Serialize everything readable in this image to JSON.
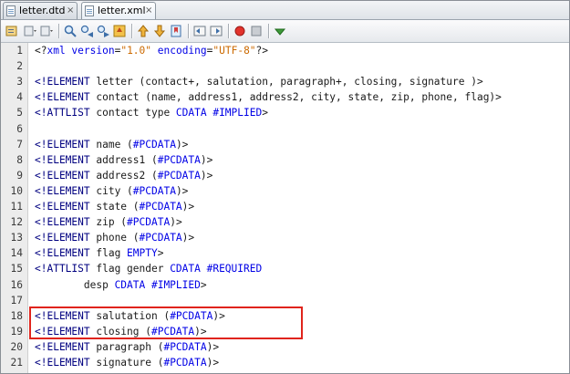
{
  "tabs": [
    {
      "label": "letter.dtd",
      "close": "×"
    },
    {
      "label": "letter.xml",
      "close": "×"
    }
  ],
  "toolbar": {
    "icons": [
      "source-view-icon",
      "back-history-icon",
      "forward-history-icon",
      "find-icon",
      "find-previous-icon",
      "find-next-icon",
      "toggle-highlight-icon",
      "previous-bookmark-icon",
      "next-bookmark-icon",
      "toggle-bookmark-icon",
      "shift-left-icon",
      "shift-right-icon",
      "start-macro-icon",
      "stop-macro-icon",
      "check-xml-icon"
    ]
  },
  "editor": {
    "lines": [
      {
        "n": "1",
        "segs": [
          {
            "t": "<?",
            "c": ""
          },
          {
            "t": "xml version",
            "c": "blue"
          },
          {
            "t": "=",
            "c": ""
          },
          {
            "t": "\"1.0\"",
            "c": "str"
          },
          {
            "t": " encoding",
            "c": "blue"
          },
          {
            "t": "=",
            "c": ""
          },
          {
            "t": "\"UTF-8\"",
            "c": "str"
          },
          {
            "t": "?>",
            "c": ""
          }
        ]
      },
      {
        "n": "2",
        "segs": []
      },
      {
        "n": "3",
        "segs": [
          {
            "t": "<!ELEMENT",
            "c": "k"
          },
          {
            "t": " letter (contact+, salutation, paragraph+, closing, signature )>",
            "c": ""
          }
        ]
      },
      {
        "n": "4",
        "segs": [
          {
            "t": "<!ELEMENT",
            "c": "k"
          },
          {
            "t": " contact (name, address1, address2, city, state, zip, phone, flag)>",
            "c": ""
          }
        ]
      },
      {
        "n": "5",
        "segs": [
          {
            "t": "<!ATTLIST",
            "c": "k"
          },
          {
            "t": " contact type ",
            "c": ""
          },
          {
            "t": "CDATA #IMPLIED",
            "c": "blue"
          },
          {
            "t": ">",
            "c": ""
          }
        ]
      },
      {
        "n": "6",
        "segs": []
      },
      {
        "n": "7",
        "segs": [
          {
            "t": "<!ELEMENT",
            "c": "k"
          },
          {
            "t": " name (",
            "c": ""
          },
          {
            "t": "#PCDATA",
            "c": "blue"
          },
          {
            "t": ")>",
            "c": ""
          }
        ]
      },
      {
        "n": "8",
        "segs": [
          {
            "t": "<!ELEMENT",
            "c": "k"
          },
          {
            "t": " address1 (",
            "c": ""
          },
          {
            "t": "#PCDATA",
            "c": "blue"
          },
          {
            "t": ")>",
            "c": ""
          }
        ]
      },
      {
        "n": "9",
        "segs": [
          {
            "t": "<!ELEMENT",
            "c": "k"
          },
          {
            "t": " address2 (",
            "c": ""
          },
          {
            "t": "#PCDATA",
            "c": "blue"
          },
          {
            "t": ")>",
            "c": ""
          }
        ]
      },
      {
        "n": "10",
        "segs": [
          {
            "t": "<!ELEMENT",
            "c": "k"
          },
          {
            "t": " city (",
            "c": ""
          },
          {
            "t": "#PCDATA",
            "c": "blue"
          },
          {
            "t": ")>",
            "c": ""
          }
        ]
      },
      {
        "n": "11",
        "segs": [
          {
            "t": "<!ELEMENT",
            "c": "k"
          },
          {
            "t": " state (",
            "c": ""
          },
          {
            "t": "#PCDATA",
            "c": "blue"
          },
          {
            "t": ")>",
            "c": ""
          }
        ]
      },
      {
        "n": "12",
        "segs": [
          {
            "t": "<!ELEMENT",
            "c": "k"
          },
          {
            "t": " zip (",
            "c": ""
          },
          {
            "t": "#PCDATA",
            "c": "blue"
          },
          {
            "t": ")>",
            "c": ""
          }
        ]
      },
      {
        "n": "13",
        "segs": [
          {
            "t": "<!ELEMENT",
            "c": "k"
          },
          {
            "t": " phone (",
            "c": ""
          },
          {
            "t": "#PCDATA",
            "c": "blue"
          },
          {
            "t": ")>",
            "c": ""
          }
        ]
      },
      {
        "n": "14",
        "segs": [
          {
            "t": "<!ELEMENT",
            "c": "k"
          },
          {
            "t": " flag ",
            "c": ""
          },
          {
            "t": "EMPTY",
            "c": "blue"
          },
          {
            "t": ">",
            "c": ""
          }
        ]
      },
      {
        "n": "15",
        "segs": [
          {
            "t": "<!ATTLIST",
            "c": "k"
          },
          {
            "t": " flag gender ",
            "c": ""
          },
          {
            "t": "CDATA #REQUIRED",
            "c": "blue"
          }
        ]
      },
      {
        "n": "16",
        "segs": [
          {
            "t": "        desp ",
            "c": ""
          },
          {
            "t": "CDATA #IMPLIED",
            "c": "blue"
          },
          {
            "t": ">",
            "c": ""
          }
        ]
      },
      {
        "n": "17",
        "segs": []
      },
      {
        "n": "18",
        "segs": [
          {
            "t": "<!ELEMENT",
            "c": "k"
          },
          {
            "t": " salutation (",
            "c": ""
          },
          {
            "t": "#PCDATA",
            "c": "blue"
          },
          {
            "t": ")>",
            "c": ""
          }
        ]
      },
      {
        "n": "19",
        "segs": [
          {
            "t": "<!ELEMENT",
            "c": "k"
          },
          {
            "t": " closing (",
            "c": ""
          },
          {
            "t": "#PCDATA",
            "c": "blue"
          },
          {
            "t": ")>",
            "c": ""
          }
        ]
      },
      {
        "n": "20",
        "segs": [
          {
            "t": "<!ELEMENT",
            "c": "k"
          },
          {
            "t": " paragraph (",
            "c": ""
          },
          {
            "t": "#PCDATA",
            "c": "blue"
          },
          {
            "t": ")>",
            "c": ""
          }
        ]
      },
      {
        "n": "21",
        "segs": [
          {
            "t": "<!ELEMENT",
            "c": "k"
          },
          {
            "t": " signature (",
            "c": ""
          },
          {
            "t": "#PCDATA",
            "c": "blue"
          },
          {
            "t": ")>",
            "c": ""
          }
        ]
      }
    ]
  },
  "colors": {
    "keyword": "#000080",
    "value": "#0000e6",
    "string": "#cc6a00",
    "highlight_border": "#e0241c"
  }
}
